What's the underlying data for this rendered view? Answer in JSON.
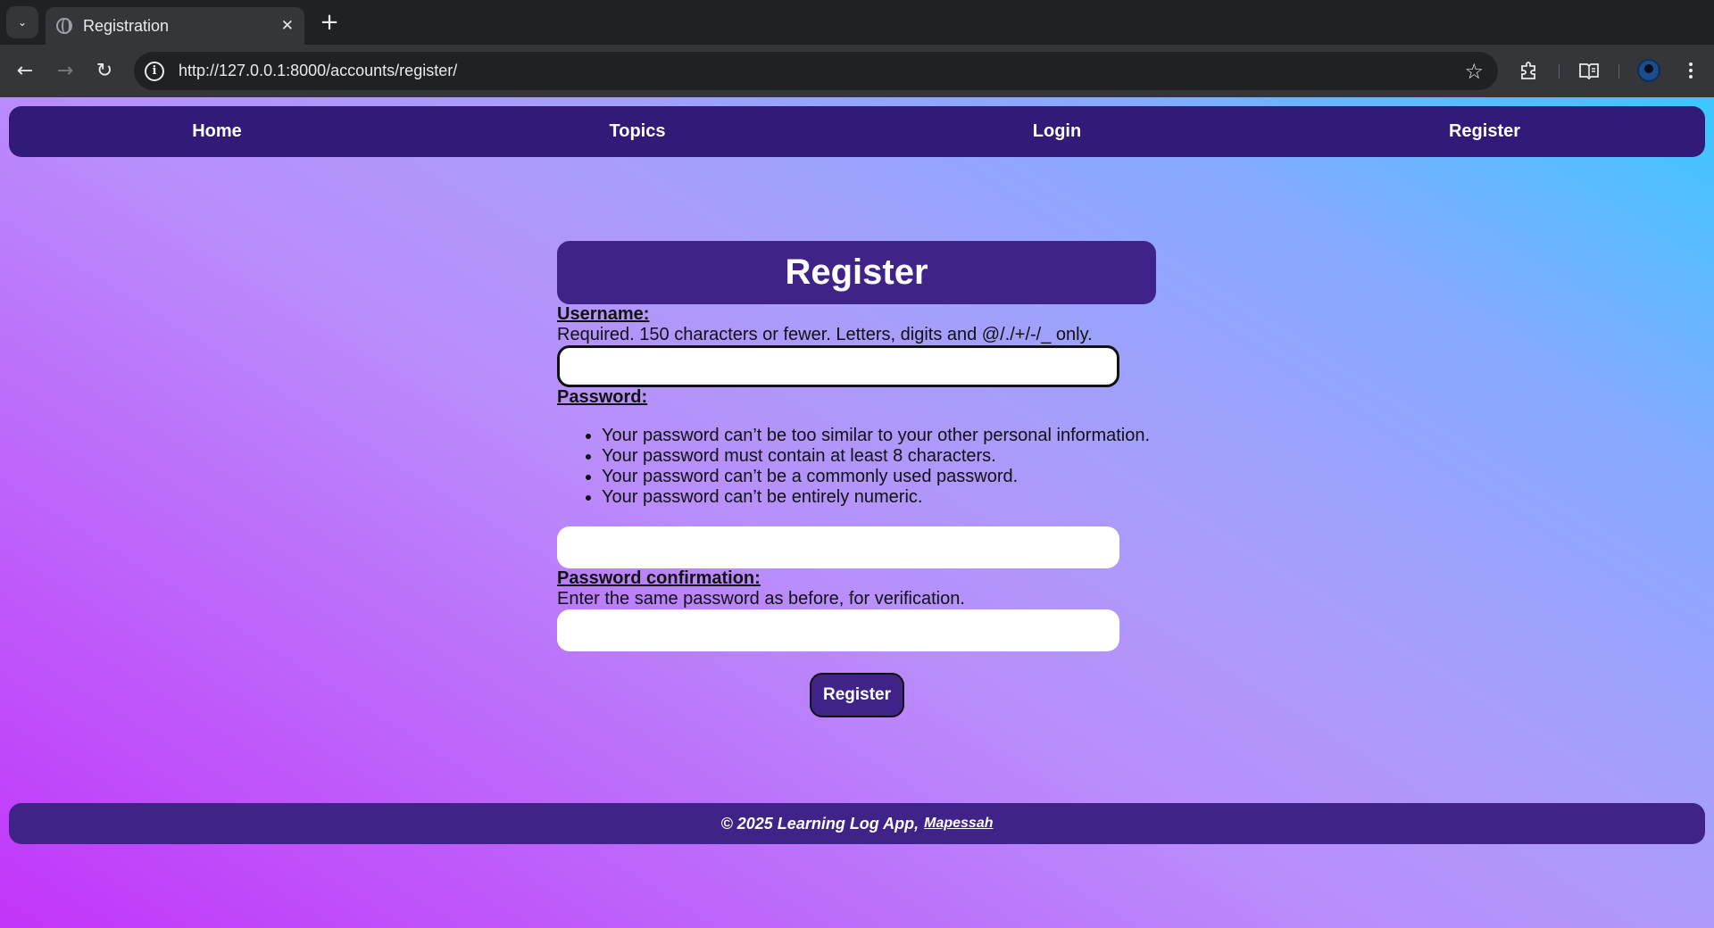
{
  "browser": {
    "tab_title": "Registration",
    "tab_close": "✕",
    "new_tab": "+",
    "tab_search": "⌄",
    "url": "http://127.0.0.1:8000/accounts/register/",
    "back": "←",
    "forward": "→",
    "reload": "↻",
    "star": "☆"
  },
  "nav": {
    "home": "Home",
    "topics": "Topics",
    "login": "Login",
    "register": "Register"
  },
  "form": {
    "title": "Register",
    "username_label": "Username:",
    "username_help": "Required. 150 characters or fewer. Letters, digits and @/./+/-/_ only.",
    "username_value": "",
    "password_label": "Password:",
    "password_rules": [
      "Your password can’t be too similar to your other personal information.",
      "Your password must contain at least 8 characters.",
      "Your password can’t be a commonly used password.",
      "Your password can’t be entirely numeric."
    ],
    "password_value": "",
    "confirm_label": "Password confirmation:",
    "confirm_help": "Enter the same password as before, for verification.",
    "confirm_value": "",
    "submit_label": "Register"
  },
  "footer": {
    "text": "© 2025 Learning Log App,",
    "author_link": "Mapessah"
  },
  "colors": {
    "nav_bg": "#321b78",
    "accent": "#3f2389",
    "gradient_start": "#c235f9",
    "gradient_end": "#3ac7ff"
  }
}
